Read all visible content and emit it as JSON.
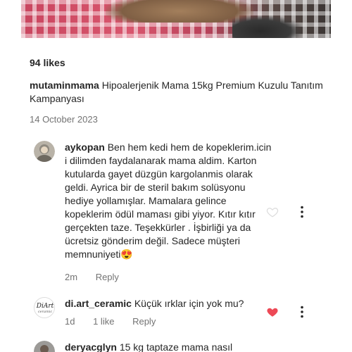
{
  "post": {
    "likes": "94 likes",
    "caption_user": "mutaminmama",
    "caption_text": "Hipoalerjenik Mama 15kg Premium Kuzulu Tanıtım Kampanyası",
    "date": "14 October 2023"
  },
  "comments": [
    {
      "user": "aykopan",
      "text": "Ben hem kedi hem de kopeklerim.icin i dilimden faydalanarak mama aldim.  Karton kutularda gayet düzgün kargolanmis olarak geldi. Ayrica bir de steril bakım solüsyonu hediye yollamışlar. Mamalara gelince kopeklerim ödül maması gibi yiyor. Kıtır kıtır gerçekten taze. Teşekkürler . İşbirliği ya da ücretsiz gönderim değil. Sadece müşteri memnuniyeti😍",
      "time": "2m",
      "reply": "Reply",
      "liked": false
    },
    {
      "user": "di.art_ceramic",
      "text": "Küçük ırklar için yok mu?",
      "time": "1d",
      "likes": "1 like",
      "reply": "Reply",
      "liked": true
    },
    {
      "user": "deryacglyn",
      "text": "15 kg taptaze mama nasıl"
    }
  ],
  "icons": {
    "heart_outline": "heart-outline-icon",
    "heart_filled": "heart-filled-icon",
    "more": "more-vertical-icon"
  },
  "colors": {
    "liked_heart": "#ed4956",
    "secondary_text": "#737373"
  }
}
